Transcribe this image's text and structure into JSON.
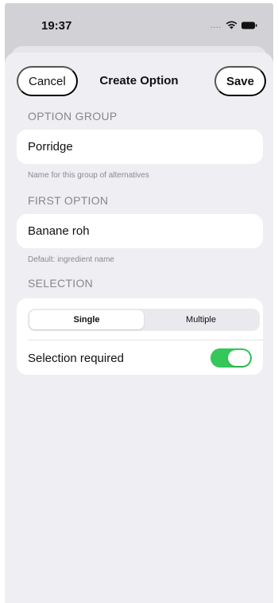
{
  "status_bar": {
    "time": "19:37",
    "signal": "....",
    "wifi_icon": "wifi-icon",
    "battery_icon": "battery-icon"
  },
  "nav": {
    "cancel_label": "Cancel",
    "title": "Create Option",
    "save_label": "Save"
  },
  "option_group": {
    "header": "OPTION GROUP",
    "value": "Porridge",
    "hint": "Name for this group of alternatives"
  },
  "first_option": {
    "header": "FIRST OPTION",
    "value": "Banane roh",
    "hint": "Default: ingredient name"
  },
  "selection": {
    "header": "SELECTION",
    "segments": [
      "Single",
      "Multiple"
    ],
    "selected_segment": "Single",
    "required_label": "Selection required",
    "required_on": true
  },
  "colors": {
    "toggle_on": "#34c759",
    "sheet_background": "#efeff3",
    "backdrop": "#d2d2d6"
  }
}
